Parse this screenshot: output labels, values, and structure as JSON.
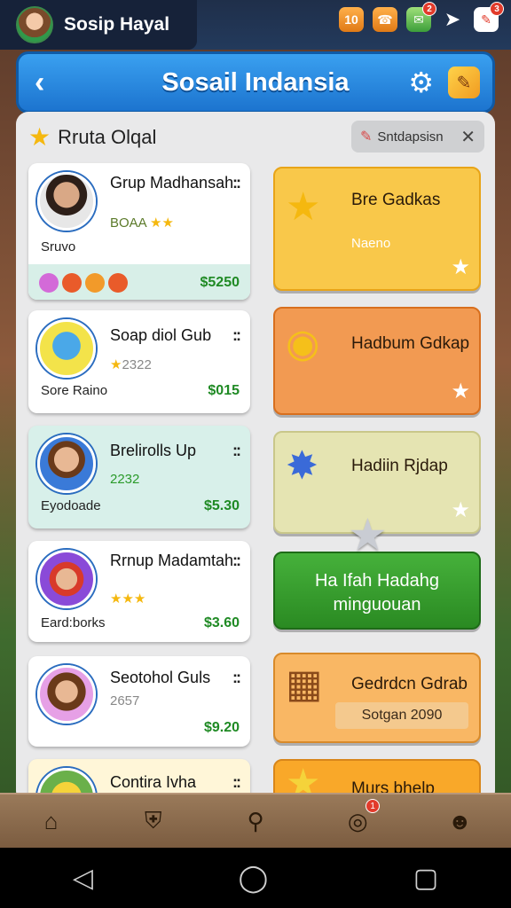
{
  "topbar": {
    "profile_name": "Sosip Hayal",
    "icons": [
      {
        "name": "coin-icon",
        "label": "10"
      },
      {
        "name": "phone-icon",
        "label": ""
      },
      {
        "name": "message-icon",
        "badge": "2"
      },
      {
        "name": "pointer-icon",
        "label": ""
      },
      {
        "name": "mail-icon",
        "badge": "3"
      }
    ]
  },
  "header": {
    "title": "Sosail Indansia",
    "back_icon": "back-icon",
    "settings_icon": "gear-icon",
    "edit_icon": "edit-icon"
  },
  "section": {
    "title": "Rruta Olqal",
    "filter_label": "Sntdapsisn"
  },
  "cards": [
    {
      "name": "Grup Madhansah",
      "rating": "BOAA",
      "sub": "Sruvo",
      "price": "$5250"
    },
    {
      "name": "Soap diol Gub",
      "rating": "2322",
      "sub": "Sore Raino",
      "price": "$015"
    },
    {
      "name": "Brelirolls Up",
      "rating": "2232",
      "sub": "Eyodoade",
      "price": "$5.30"
    },
    {
      "name": "Rrnup Madamtah",
      "rating": "",
      "sub": "Eard:borks",
      "price": "$3.60"
    },
    {
      "name": "Seotohol Guls",
      "rating": "2657",
      "sub": "",
      "price": "$9.20"
    },
    {
      "name": "Contira Ivha",
      "rating": "",
      "sub": "",
      "price": ""
    }
  ],
  "tiles": [
    {
      "label": "Bre Gadkas",
      "sub": "Naeno",
      "color": "#f9c84a"
    },
    {
      "label": "Hadbum Gdkap",
      "sub": "",
      "color": "#f29a52"
    },
    {
      "label": "Hadiin Rjdap",
      "sub": "",
      "color": "#e5e4b2"
    },
    {
      "label": "Ha Ifah Hadahg minguouan",
      "sub": "",
      "color": "#3fa836"
    },
    {
      "label": "Gedrdcn Gdrab",
      "sub": "Sotgan 2090",
      "color": "#f9b764"
    },
    {
      "label": "Murs bhelp",
      "sub": "",
      "color": "#f9a829"
    }
  ],
  "bottomnav": [
    {
      "name": "home-icon"
    },
    {
      "name": "shield-icon"
    },
    {
      "name": "search-icon"
    },
    {
      "name": "compass-icon",
      "badge": "1"
    },
    {
      "name": "profile-icon"
    }
  ]
}
